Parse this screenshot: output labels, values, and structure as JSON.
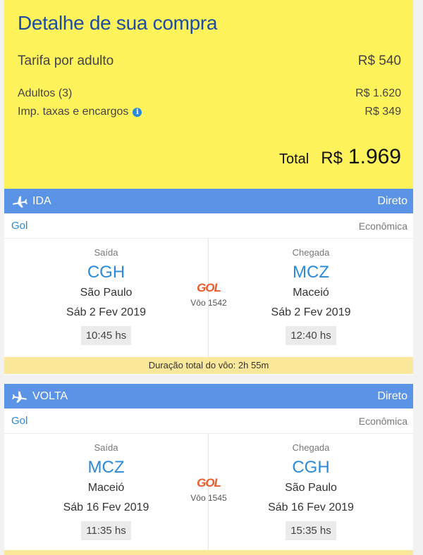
{
  "summary": {
    "title": "Detalhe de sua compra",
    "fare_label": "Tarifa por adulto",
    "fare_value": "R$ 540",
    "adults_label": "Adultos (3)",
    "adults_value": "R$ 1.620",
    "taxes_label": "Imp. taxas e encargos",
    "taxes_value": "R$ 349",
    "total_label": "Total",
    "total_currency": "R$",
    "total_value": "1.969"
  },
  "ida": {
    "label": "IDA",
    "type": "Direto",
    "airline": "Gol",
    "cabin": "Econômica",
    "departure": {
      "caption": "Saída",
      "code": "CGH",
      "city": "São Paulo",
      "date": "Sáb 2 Fev 2019",
      "time": "10:45 hs"
    },
    "arrival": {
      "caption": "Chegada",
      "code": "MCZ",
      "city": "Maceió",
      "date": "Sáb 2 Fev 2019",
      "time": "12:40 hs"
    },
    "logo": "GOL",
    "flight": "Vôo 1542",
    "duration": "Duração total do vôo: 2h 55m"
  },
  "volta": {
    "label": "VOLTA",
    "type": "Direto",
    "airline": "Gol",
    "cabin": "Econômica",
    "departure": {
      "caption": "Saída",
      "code": "MCZ",
      "city": "Maceió",
      "date": "Sáb 16 Fev 2019",
      "time": "11:35 hs"
    },
    "arrival": {
      "caption": "Chegada",
      "code": "CGH",
      "city": "São Paulo",
      "date": "Sáb 16 Fev 2019",
      "time": "15:35 hs"
    },
    "logo": "GOL",
    "flight": "Vôo 1545"
  },
  "colors": {
    "summary_bg": "#fff35c",
    "header_bg": "#5b93e6",
    "accent": "#2a8ad9",
    "title": "#1d4da1",
    "duration_bg": "#fbe89a",
    "logo": "#ea5b2c"
  },
  "icons": {
    "ida": "plane-departure-icon",
    "volta": "plane-return-icon",
    "info": "info-icon"
  }
}
